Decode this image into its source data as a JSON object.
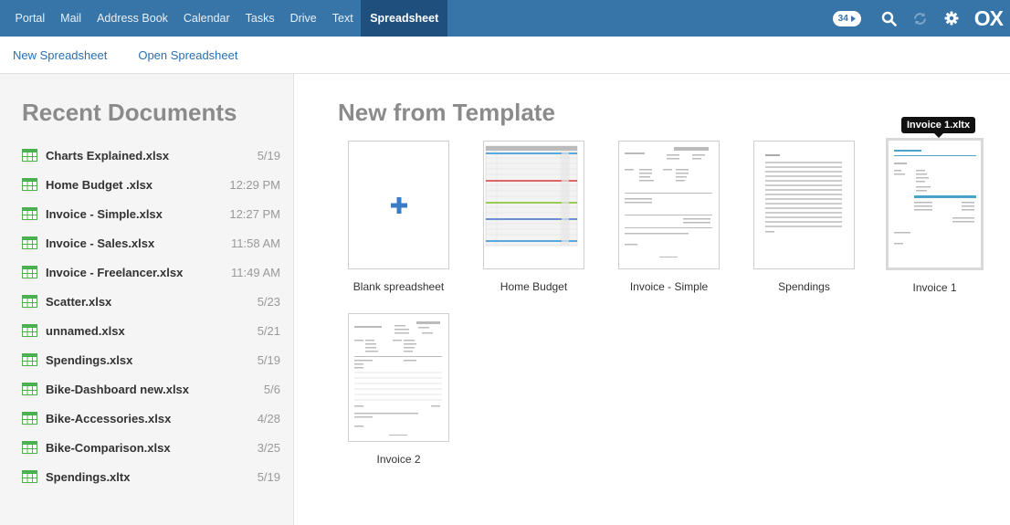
{
  "nav": {
    "items": [
      {
        "label": "Portal"
      },
      {
        "label": "Mail"
      },
      {
        "label": "Address Book"
      },
      {
        "label": "Calendar"
      },
      {
        "label": "Tasks"
      },
      {
        "label": "Drive"
      },
      {
        "label": "Text"
      },
      {
        "label": "Spreadsheet",
        "active": true
      }
    ],
    "notification_count": "34",
    "logo": "OX"
  },
  "toolbar": {
    "new_label": "New Spreadsheet",
    "open_label": "Open Spreadsheet"
  },
  "sidebar": {
    "title": "Recent Documents",
    "documents": [
      {
        "name": "Charts Explained.xlsx",
        "date": "5/19"
      },
      {
        "name": "Home Budget .xlsx",
        "date": "12:29 PM"
      },
      {
        "name": "Invoice - Simple.xlsx",
        "date": "12:27 PM"
      },
      {
        "name": "Invoice - Sales.xlsx",
        "date": "11:58 AM"
      },
      {
        "name": "Invoice - Freelancer.xlsx",
        "date": "11:49 AM"
      },
      {
        "name": "Scatter.xlsx",
        "date": "5/23"
      },
      {
        "name": "unnamed.xlsx",
        "date": "5/21"
      },
      {
        "name": "Spendings.xlsx",
        "date": "5/19"
      },
      {
        "name": "Bike-Dashboard new.xlsx",
        "date": "5/6"
      },
      {
        "name": "Bike-Accessories.xlsx",
        "date": "4/28"
      },
      {
        "name": "Bike-Comparison.xlsx",
        "date": "3/25"
      },
      {
        "name": "Spendings.xltx",
        "date": "5/19"
      }
    ]
  },
  "main": {
    "title": "New from Template",
    "templates": [
      {
        "label": "Blank spreadsheet"
      },
      {
        "label": "Home Budget"
      },
      {
        "label": "Invoice - Simple"
      },
      {
        "label": "Spendings"
      },
      {
        "label": "Invoice 1"
      },
      {
        "label": "Invoice 2"
      }
    ],
    "tooltip": "Invoice 1.xltx"
  },
  "colors": {
    "nav_bg": "#3774a8",
    "nav_active": "#1f4f7d",
    "link": "#2a6fb0",
    "sheet_icon": "#4caf50",
    "plus": "#3b7dc4"
  }
}
